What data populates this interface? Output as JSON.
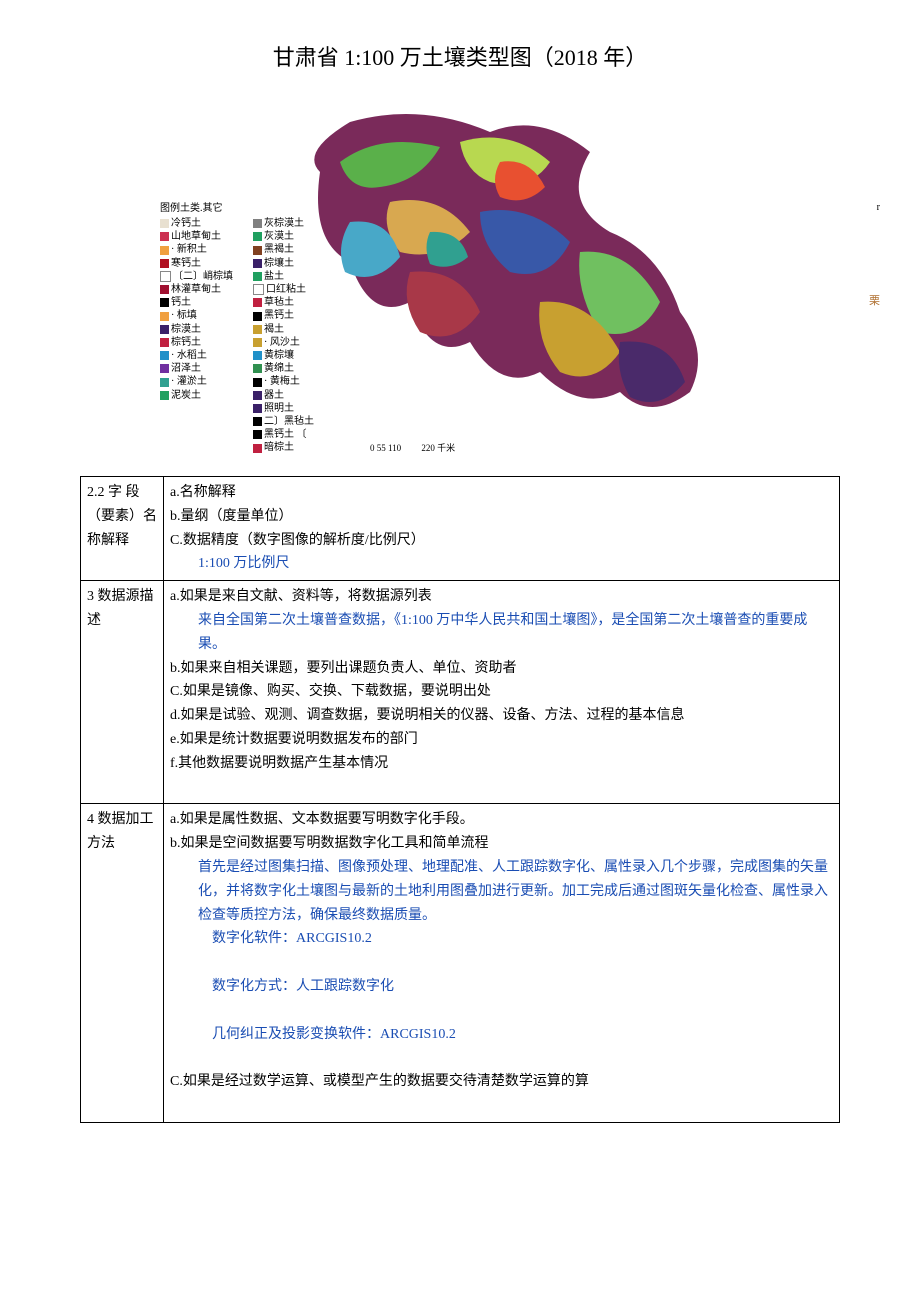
{
  "title": "甘肃省 1:100 万土壤类型图（2018 年）",
  "legend_header": "图例土类.其它",
  "legend_col1": [
    {
      "color": "#e8e0d0",
      "label": "冷钙土"
    },
    {
      "color": "#cc3050",
      "label": "山地草甸土"
    },
    {
      "color": "#f0a040",
      "label": "· 新积土"
    },
    {
      "color": "#b01020",
      "label": "寒钙土"
    },
    {
      "color": "#ffffff",
      "label": "〔二〕峭棕填"
    },
    {
      "color": "#a01030",
      "label": "林灌草甸土"
    },
    {
      "color": "#000000",
      "label": "钙土"
    },
    {
      "color": "#f0a040",
      "label": "· 标填"
    },
    {
      "color": "#3a2068",
      "label": "棕漠土"
    },
    {
      "color": "#c02040",
      "label": "棕钙土"
    },
    {
      "color": "#2090c8",
      "label": "· 水稻土"
    },
    {
      "color": "#7030a0",
      "label": "沼泽土"
    },
    {
      "color": "#30a090",
      "label": "· 灌淤土"
    },
    {
      "color": "",
      "label": ""
    },
    {
      "color": "#20a060",
      "label": "泥炭土"
    }
  ],
  "legend_col2": [
    {
      "color": "#808080",
      "label": "灰棕漠土"
    },
    {
      "color": "#20a060",
      "label": "灰漠土"
    },
    {
      "color": "#804020",
      "label": "黑褐土"
    },
    {
      "color": "#3a2068",
      "label": "棕壤土"
    },
    {
      "color": "#20a060",
      "label": "盐土"
    },
    {
      "color": "#ffffff",
      "label": "口红粘土"
    },
    {
      "color": "#c02040",
      "label": "草毡土"
    },
    {
      "color": "",
      "label": ""
    },
    {
      "color": "#000000",
      "label": "黑钙土"
    },
    {
      "color": "#c8a030",
      "label": "褐土"
    },
    {
      "color": "#c8a030",
      "label": "· 风沙土"
    },
    {
      "color": "#2090c8",
      "label": "黄棕壤"
    },
    {
      "color": "#309050",
      "label": "黄绵土"
    },
    {
      "color": "#000000",
      "label": "· 黄梅土"
    },
    {
      "color": "#3a2068",
      "label": "器土"
    },
    {
      "color": "#3a2068",
      "label": "照明土"
    },
    {
      "color": "#000000",
      "label": "二〕黑毡土"
    },
    {
      "color": "#000000",
      "label": "黑钙土 〔"
    },
    {
      "color": "#c02040",
      "label": "暗棕土"
    }
  ],
  "side_char": "栗",
  "r_mark": "r",
  "scale_numbers": "0 55 110",
  "scale_end": "220 千米",
  "row22_left": "2.2 字 段（要素）名称解释",
  "row22_a": "a.名称解释",
  "row22_b": "b.量纲（度量单位）",
  "row22_c": "C.数据精度（数字图像的解析度/比例尺）",
  "row22_c_val": "1:100 万比例尺",
  "row3_left": "3 数据源描述",
  "row3_a": "a.如果是来自文献、资料等，将数据源列表",
  "row3_a_val": "来自全国第二次土壤普查数据，《1:100 万中华人民共和国土壤图》，是全国第二次土壤普查的重要成果。",
  "row3_b": "b.如果来自相关课题，要列出课题负责人、单位、资助者",
  "row3_c": "C.如果是镜像、购买、交换、下载数据，要说明出处",
  "row3_d": "d.如果是试验、观测、调查数据，要说明相关的仪器、设备、方法、过程的基本信息",
  "row3_e": "e.如果是统计数据要说明数据发布的部门",
  "row3_f": "f.其他数据要说明数据产生基本情况",
  "row4_left": "4 数据加工方法",
  "row4_a": "a.如果是属性数据、文本数据要写明数字化手段。",
  "row4_b": "b.如果是空间数据要写明数据数字化工具和简单流程",
  "row4_b_val": "首先是经过图集扫描、图像预处理、地理配准、人工跟踪数字化、属性录入几个步骤，完成图集的矢量化，并将数字化土壤图与最新的土地利用图叠加进行更新。加工完成后通过图斑矢量化检查、属性录入检查等质控方法，确保最终数据质量。",
  "row4_sw": "数字化软件：ARCGIS10.2",
  "row4_way": "数字化方式：人工跟踪数字化",
  "row4_geo": "几何纠正及投影变换软件：ARCGIS10.2",
  "row4_c": "C.如果是经过数学运算、或模型产生的数据要交待清楚数学运算的算"
}
